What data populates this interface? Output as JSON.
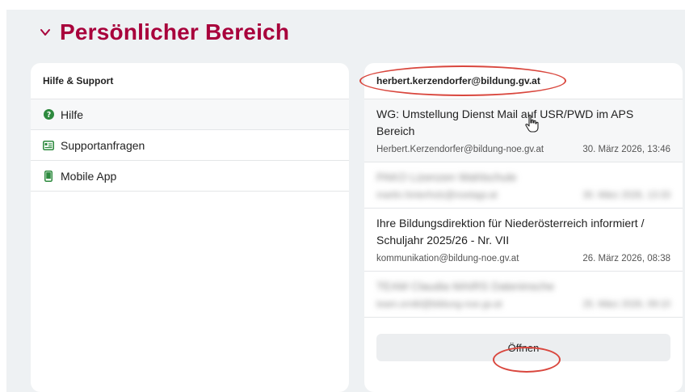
{
  "section": {
    "title": "Persönlicher Bereich",
    "icon": "chevron-down-icon",
    "accent_color": "#a8003b"
  },
  "support": {
    "header": "Hilfe & Support",
    "items": [
      {
        "label": "Hilfe",
        "icon": "help-circle-icon"
      },
      {
        "label": "Supportanfragen",
        "icon": "id-card-icon"
      },
      {
        "label": "Mobile App",
        "icon": "mobile-phone-icon"
      }
    ]
  },
  "mail": {
    "account": "herbert.kerzendorfer@bildung.gv.at",
    "items": [
      {
        "subject": "WG: Umstellung Dienst Mail auf USR/PWD im APS Bereich",
        "sender": "Herbert.Kerzendorfer@bildung-noe.gv.at",
        "date": "30. März 2026, 13:46"
      },
      {
        "subject": "PAKO Lizenzen Wahlschule",
        "sender": "martin.hinterholz@noetagv.at",
        "date": "30. März 2026, 13:33"
      },
      {
        "subject": "Ihre Bildungsdirektion für Niederösterreich informiert / Schuljahr 2025/26 - Nr. VII",
        "sender": "kommunikation@bildung-noe.gv.at",
        "date": "26. März 2026, 08:38"
      },
      {
        "subject": "TEAM Claudia MAIRS Dateninsche",
        "sender": "team.ornikl@bildung-noe.gv.at",
        "date": "25. März 2026, 09:10"
      }
    ],
    "open_label": "Öffnen"
  }
}
